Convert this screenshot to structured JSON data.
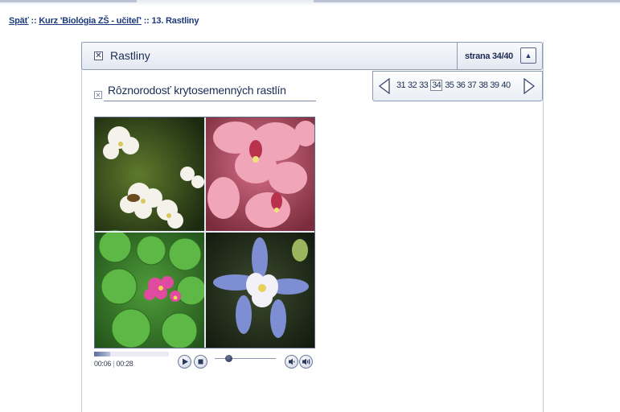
{
  "breadcrumb": {
    "back_label": "Späť",
    "sep1": "::",
    "course_label": "Kurz 'Biológia ZŠ - učiteľ'",
    "sep2": "::",
    "current": "13. Rastliny"
  },
  "header": {
    "title": "Rastliny",
    "page_indicator": "strana 34/40"
  },
  "pager": {
    "pages": [
      "31",
      "32",
      "33",
      "34",
      "35",
      "36",
      "37",
      "38",
      "39",
      "40"
    ],
    "current_page": "34"
  },
  "section": {
    "title": "Rôznorodosť krytosemenných rastlín"
  },
  "player": {
    "elapsed": "00:06",
    "separator": "|",
    "total": "00:28",
    "progress_fraction": 0.214,
    "volume_fraction": 0.22
  },
  "colors": {
    "link": "#1d3a7c",
    "border": "#8c9ab4",
    "text": "#1c2d54"
  },
  "icons": {
    "header_toggle": "close-box-icon",
    "collapse": "triangle-up-icon",
    "prev": "triangle-left-icon",
    "next": "triangle-right-icon",
    "play": "play-icon",
    "stop": "stop-icon"
  }
}
